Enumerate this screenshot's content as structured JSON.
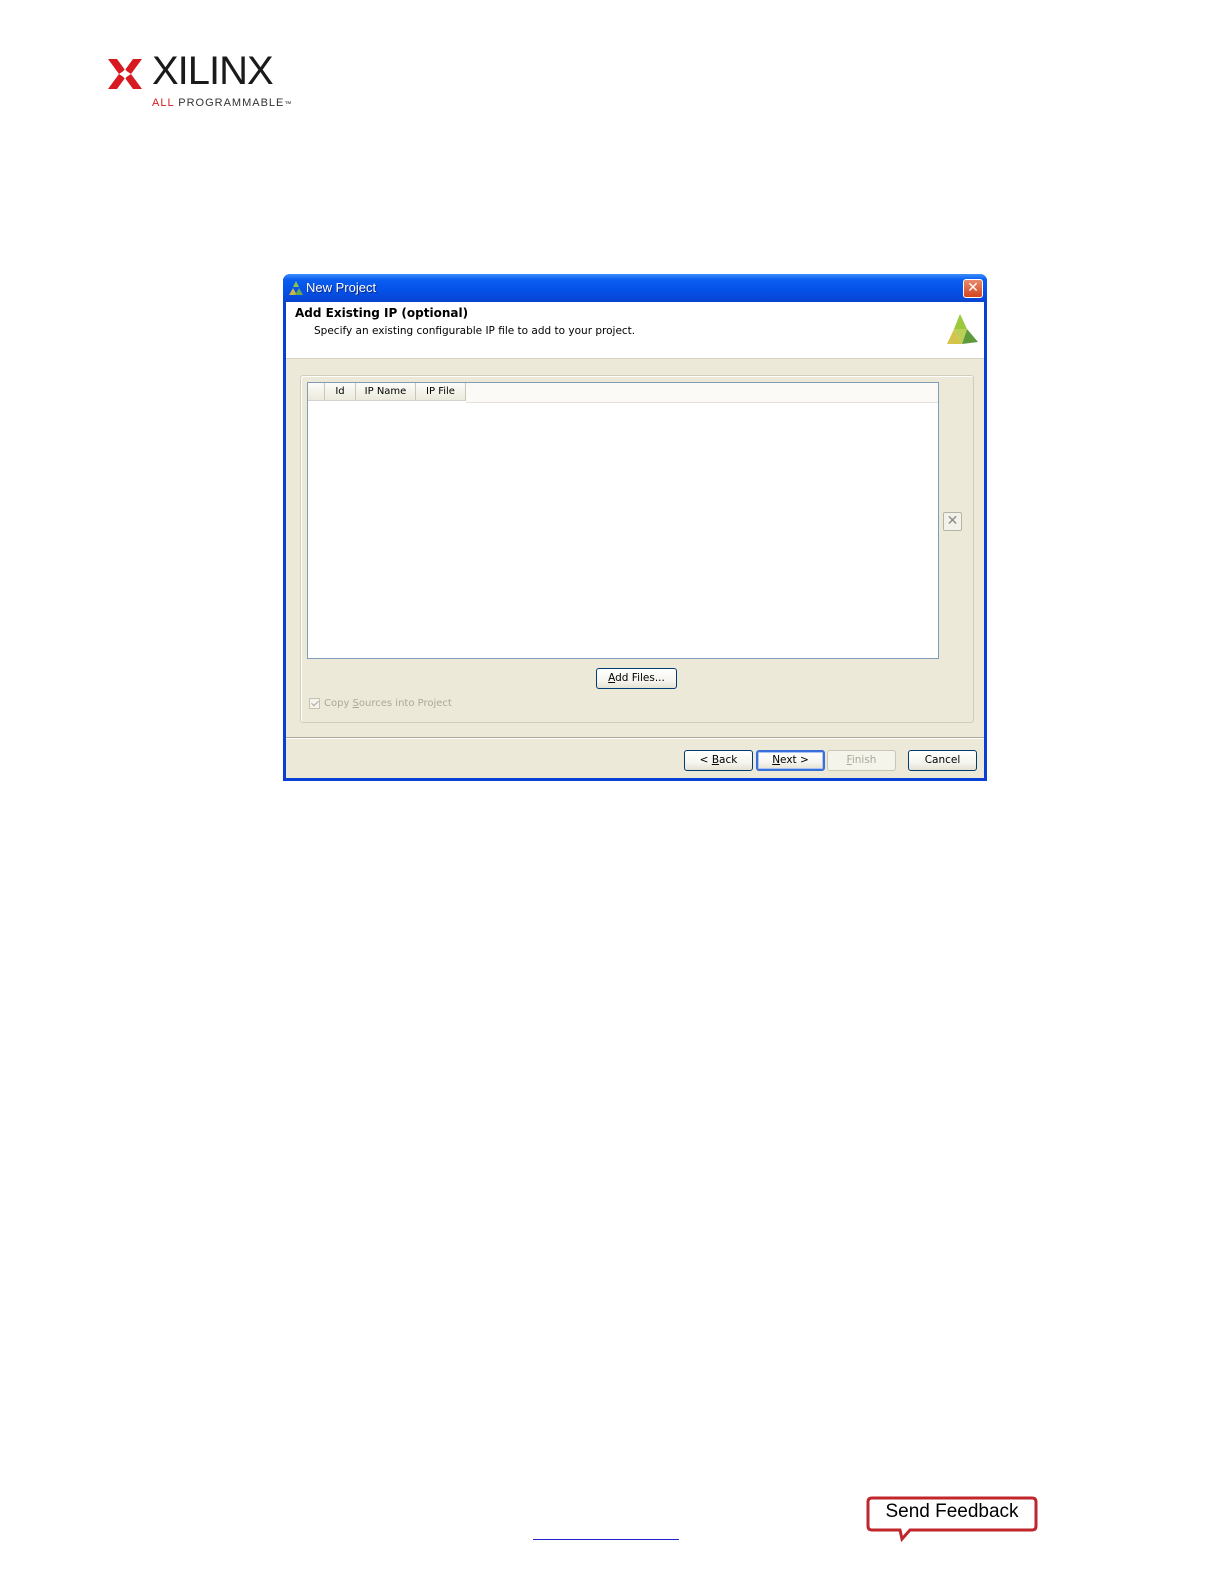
{
  "logo": {
    "wordmark": "XILINX",
    "tagline_accent": "ALL",
    "tagline_rest": " PROGRAMMABLE",
    "tagline_mark": "™",
    "brand_color": "#d71920"
  },
  "dialog": {
    "title": "New Project",
    "close_glyph": "✕",
    "header": {
      "title": "Add Existing IP (optional)",
      "subtitle": "Specify an existing configurable IP file to add to your project."
    },
    "table": {
      "columns": [
        "",
        "Id",
        "IP Name",
        "IP File"
      ],
      "rows": []
    },
    "remove_glyph": "✕",
    "add_files_label_underlined": "A",
    "add_files_label_rest": "dd Files...",
    "copy_sources": {
      "checked": true,
      "enabled": false,
      "label_pre": "Copy ",
      "label_underlined": "S",
      "label_post": "ources into Project"
    },
    "buttons": {
      "back_pre": "< ",
      "back_underlined": "B",
      "back_post": "ack",
      "next_underlined": "N",
      "next_post": "ext >",
      "finish_underlined": "F",
      "finish_post": "inish",
      "cancel": "Cancel"
    },
    "colors": {
      "titlebar": "#0550e8",
      "client_bg": "#ece9d8"
    }
  },
  "page_footer": {
    "send_feedback": "Send Feedback",
    "feedback_color": "#c0272d"
  }
}
